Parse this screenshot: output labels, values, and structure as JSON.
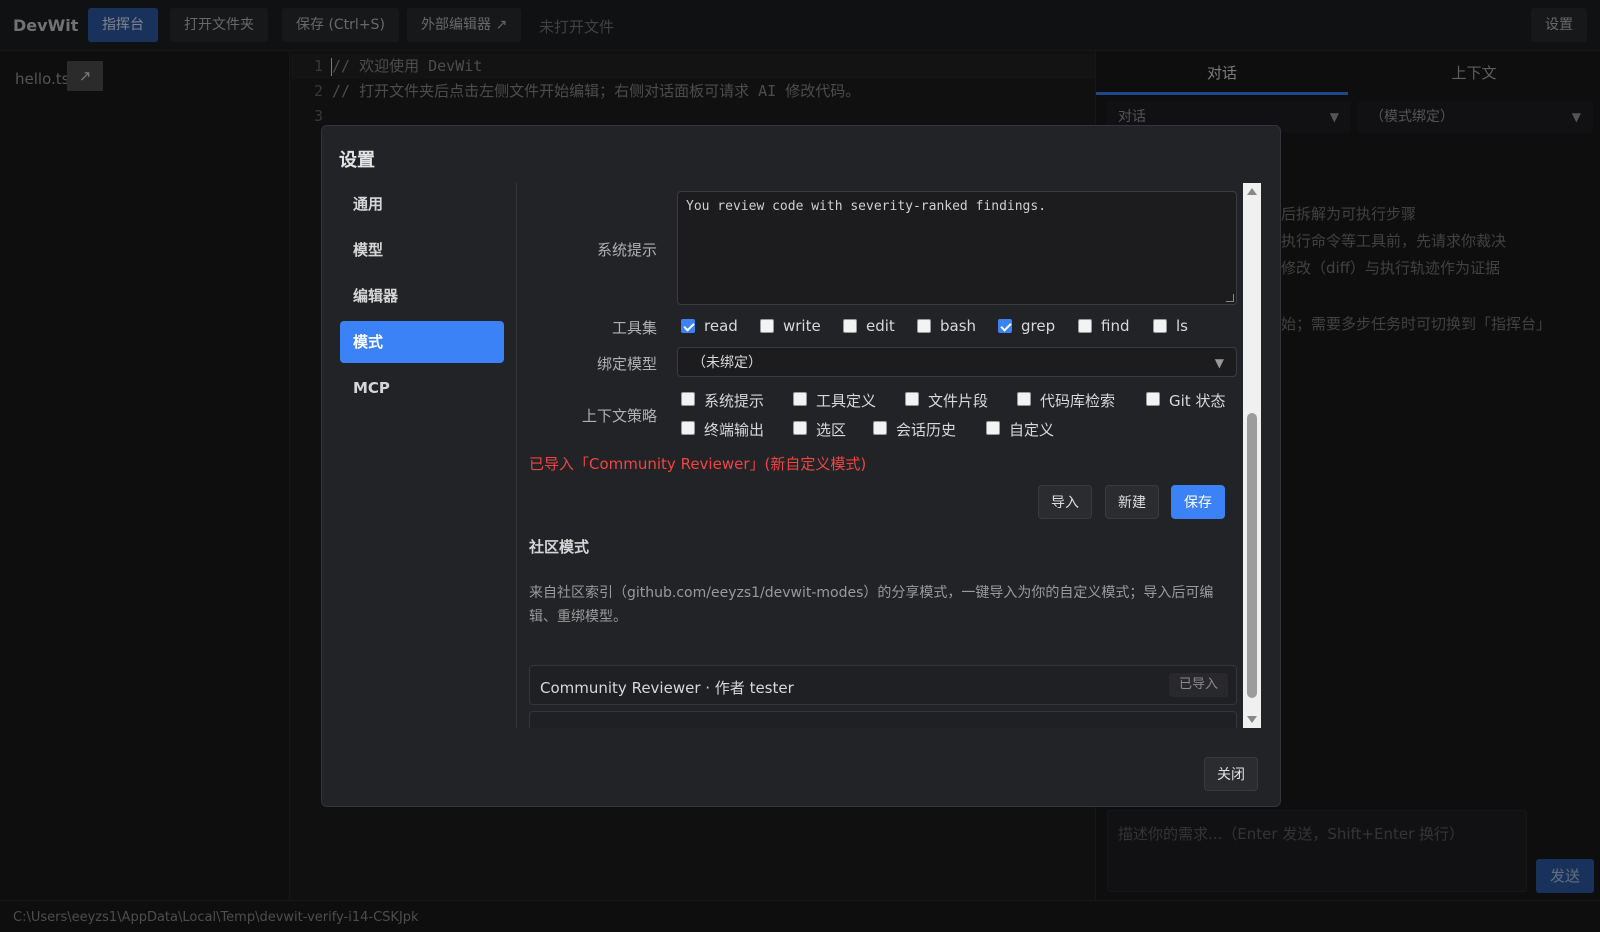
{
  "app": {
    "brand": "DevWit"
  },
  "toolbar": {
    "command_center": "指挥台",
    "open_folder": "打开文件夹",
    "save": "保存 (Ctrl+S)",
    "external_editor": "外部编辑器 ↗",
    "no_file": "未打开文件",
    "settings": "设置"
  },
  "sidebar": {
    "file": "hello.ts",
    "open_external": "↗"
  },
  "editor": {
    "lines": [
      {
        "num": "1",
        "text": "// 欢迎使用 DevWit"
      },
      {
        "num": "2",
        "text": "// 打开文件夹后点击左侧文件开始编辑；右侧对话面板可请求 AI 修改代码。"
      },
      {
        "num": "3",
        "text": ""
      }
    ]
  },
  "right_panel": {
    "tabs": [
      "对话",
      "上下文"
    ],
    "mode_select": "对话",
    "model_select": "（模式绑定）",
    "bg_lines": [
      "后拆解为可执行步骤",
      "执行命令等工具前，先请求你裁决",
      "修改（diff）与执行轨迹作为证据",
      "始；需要多步任务时可切换到「指挥台」"
    ],
    "input_placeholder": "描述你的需求...（Enter 发送，Shift+Enter 换行）",
    "send": "发送"
  },
  "statusbar": {
    "path": "C:\\Users\\eeyzs1\\AppData\\Local\\Temp\\devwit-verify-i14-CSKJpk"
  },
  "settings": {
    "title": "设置",
    "nav": [
      "通用",
      "模型",
      "编辑器",
      "模式",
      "MCP"
    ],
    "active_nav": "模式",
    "system_prompt_label": "系统提示",
    "system_prompt_value": "You review code with severity-ranked findings.",
    "toolset_label": "工具集",
    "tools": [
      {
        "name": "read",
        "checked": true
      },
      {
        "name": "write",
        "checked": false
      },
      {
        "name": "edit",
        "checked": false
      },
      {
        "name": "bash",
        "checked": false
      },
      {
        "name": "grep",
        "checked": true
      },
      {
        "name": "find",
        "checked": false
      },
      {
        "name": "ls",
        "checked": false
      }
    ],
    "bind_model_label": "绑定模型",
    "bind_model_value": "（未绑定）",
    "context_label": "上下文策略",
    "context_options": [
      {
        "name": "系统提示",
        "checked": false
      },
      {
        "name": "工具定义",
        "checked": false
      },
      {
        "name": "文件片段",
        "checked": false
      },
      {
        "name": "代码库检索",
        "checked": false
      },
      {
        "name": "Git 状态",
        "checked": false
      },
      {
        "name": "终端输出",
        "checked": false
      },
      {
        "name": "选区",
        "checked": false
      },
      {
        "name": "会话历史",
        "checked": false
      },
      {
        "name": "自定义",
        "checked": false
      }
    ],
    "import_message": "已导入「Community Reviewer」(新自定义模式)",
    "buttons": {
      "import": "导入",
      "new": "新建",
      "save": "保存"
    },
    "community_title": "社区模式",
    "community_desc": "来自社区索引（github.com/eeyzs1/devwit-modes）的分享模式，一键导入为你的自定义模式；导入后可编辑、重绑模型。",
    "community_items": [
      {
        "text": "Community Reviewer · 作者 tester",
        "badge": "已导入"
      }
    ],
    "close": "关闭"
  }
}
